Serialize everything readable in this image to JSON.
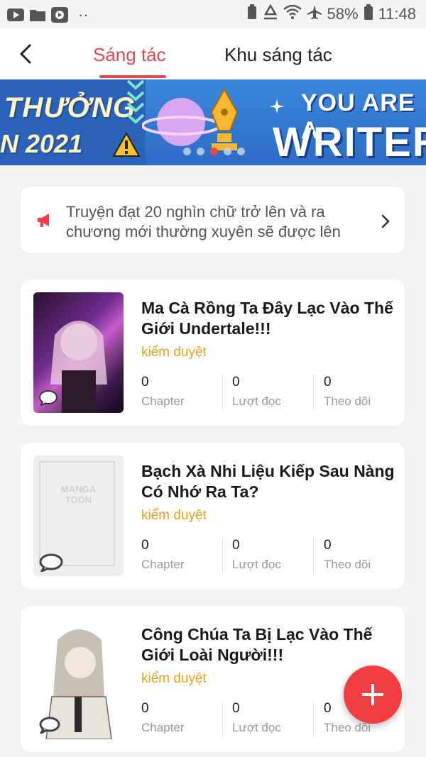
{
  "status_bar": {
    "battery": "58%",
    "time": "11:48",
    "dots": "··"
  },
  "header": {
    "tabs": [
      {
        "label": "Sáng tác"
      },
      {
        "label": "Khu sáng tác"
      }
    ]
  },
  "banner": {
    "left_line1": "THƯỞNG",
    "left_line2": "N 2021",
    "right_line1": "YOU ARE A",
    "right_line2": "WRITER"
  },
  "notice": {
    "text": "Truyện đạt 20 nghìn chữ trở lên và ra chương mới thường xuyên sẽ được lên"
  },
  "stats_labels": [
    "Chapter",
    "Lượt đọc",
    "Theo dõi"
  ],
  "stories": [
    {
      "title": "Ma Cà Rồng Ta Đây Lạc Vào Thế Giới Undertale!!!",
      "status": "kiểm duyệt",
      "chapters": "0",
      "reads": "0",
      "follows": "0"
    },
    {
      "title": "Bạch Xà Nhi Liệu Kiếp Sau Nàng Có Nhớ Ra Ta?",
      "status": "kiểm duyệt",
      "placeholder_logo_line1": "MANGA",
      "placeholder_logo_line2": "TOON",
      "chapters": "0",
      "reads": "0",
      "follows": "0"
    },
    {
      "title": "Công Chúa Ta Bị Lạc Vào Thế Giới Loài Người!!!",
      "status": "kiểm duyệt",
      "chapters": "0",
      "reads": "0",
      "follows": "0"
    }
  ],
  "colors": {
    "accent": "#e5484d",
    "status_pending": "#e8a317",
    "fab": "#ef3d42"
  }
}
